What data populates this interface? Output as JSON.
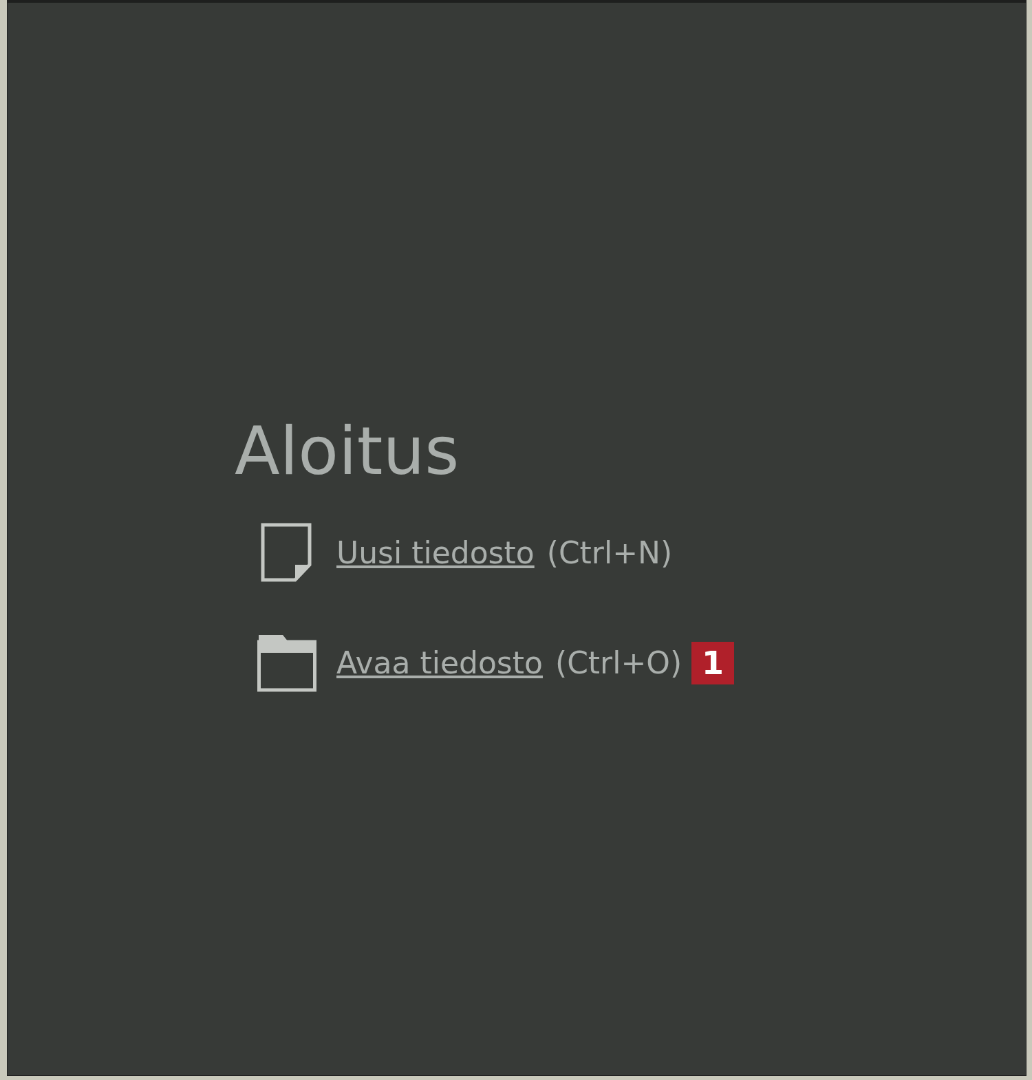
{
  "title": "Aloitus",
  "actions": [
    {
      "kind": "new",
      "link": "Uusi tiedosto",
      "shortcut": "(Ctrl+N)"
    },
    {
      "kind": "open",
      "link": "Avaa tiedosto",
      "shortcut": "(Ctrl+O)",
      "badge": "1"
    }
  ]
}
